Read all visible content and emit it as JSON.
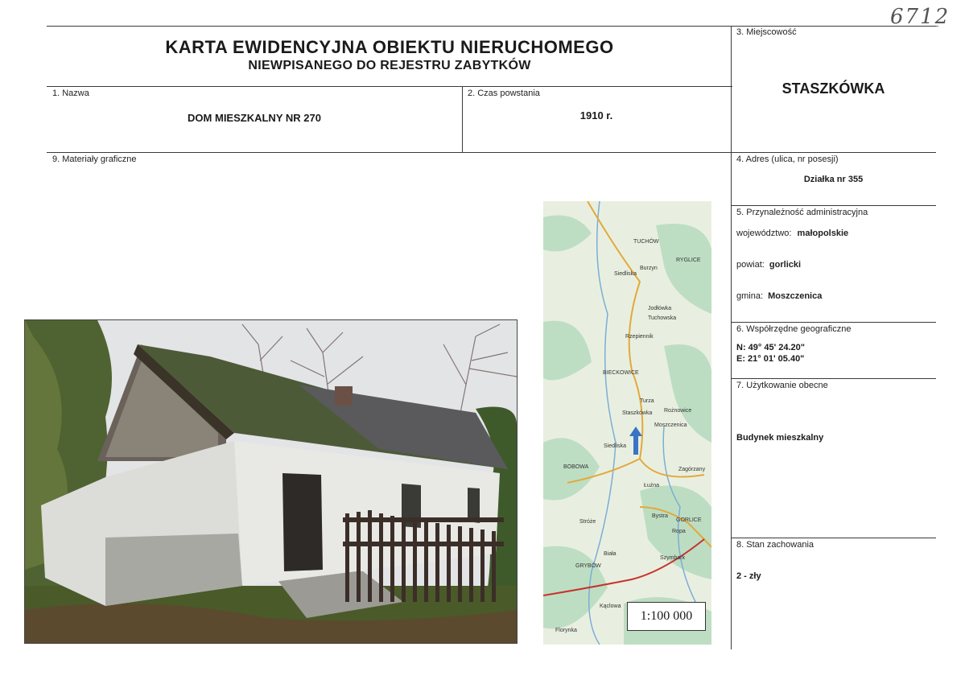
{
  "handwritten_number": "6712",
  "header": {
    "title": "KARTA EWIDENCYJNA OBIEKTU NIERUCHOMEGO",
    "subtitle": "NIEWPISANEGO DO REJESTRU ZABYTKÓW"
  },
  "fields": {
    "name": {
      "label": "1. Nazwa",
      "value": "DOM MIESZKALNY NR 270"
    },
    "built": {
      "label": "2. Czas powstania",
      "value": "1910 r."
    },
    "locality": {
      "label": "3. Miejscowość",
      "value": "STASZKÓWKA"
    },
    "address": {
      "label": "4. Adres (ulica, nr posesji)",
      "value": "Działka nr 355"
    },
    "admin": {
      "label": "5. Przynależność administracyjna",
      "voivodeship_label": "województwo:",
      "voivodeship": "małopolskie",
      "county_label": "powiat:",
      "county": "gorlicki",
      "commune_label": "gmina:",
      "commune": "Moszczenica"
    },
    "coords": {
      "label": "6. Współrzędne geograficzne",
      "n": "N: 49° 45' 24.20\"",
      "e": "E: 21° 01' 05.40\""
    },
    "usage": {
      "label": "7. Użytkowanie obecne",
      "value": "Budynek mieszkalny"
    },
    "condition": {
      "label": "8. Stan zachowania",
      "value": "2 - zły"
    },
    "graphics": {
      "label": "9. Materiały graficzne"
    }
  },
  "map": {
    "scale": "1:100 000",
    "places": [
      "TUCHÓW",
      "RYGLICE",
      "Burzyn",
      "Siedliska",
      "Jodłówka",
      "Tuchowska",
      "Rzepiennik",
      "BIECKOWICE",
      "Staszkówka",
      "Moszczenica",
      "Turza",
      "Rożnowice",
      "Siedliska",
      "BOBOWA",
      "Łużna",
      "Zagórzany",
      "GORLICE",
      "Bystra",
      "Ropa",
      "Szymbark",
      "GRYBÓW",
      "Biała",
      "Stróże",
      "Kąclowa",
      "Florynka"
    ]
  }
}
